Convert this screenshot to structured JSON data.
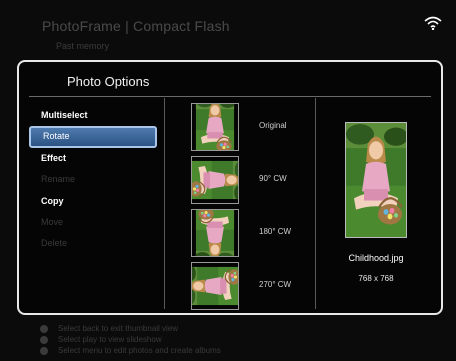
{
  "background": {
    "title": "PhotoFrame | Compact Flash",
    "subtitle": "Past memory",
    "hints": [
      "Select back to exit thumbnail view",
      "Select play to view slideshow",
      "Select menu to edit photos and create albums"
    ]
  },
  "dialog": {
    "title": "Photo Options",
    "menu": [
      {
        "label": "Multiselect",
        "state": "enabled"
      },
      {
        "label": "Rotate",
        "state": "selected"
      },
      {
        "label": "Effect",
        "state": "enabled"
      },
      {
        "label": "Rename",
        "state": "disabled"
      },
      {
        "label": "Copy",
        "state": "enabled"
      },
      {
        "label": "Move",
        "state": "disabled"
      },
      {
        "label": "Delete",
        "state": "disabled"
      }
    ],
    "rotations": [
      {
        "label": "Original",
        "degrees": 0
      },
      {
        "label": "90° CW",
        "degrees": 90
      },
      {
        "label": "180° CW",
        "degrees": 180
      },
      {
        "label": "270° CW",
        "degrees": 270
      }
    ],
    "preview": {
      "file_name": "Childhood.jpg",
      "dimensions": "768 x 768"
    }
  },
  "colors": {
    "selection": "#3d6aa2",
    "selection_border": "#a9c6ea",
    "dialog_border": "#e8e8e8",
    "disabled_text": "#3a3a3a"
  }
}
